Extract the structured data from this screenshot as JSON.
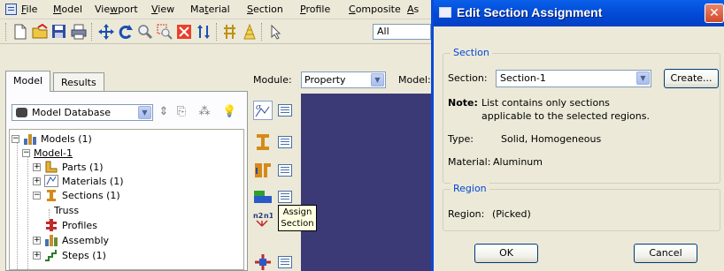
{
  "menubar": {
    "items": [
      "File",
      "Model",
      "Viewport",
      "View",
      "Material",
      "Section",
      "Profile",
      "Composite",
      "As"
    ],
    "mnemonics": [
      "F",
      "M",
      "w",
      "V",
      "t",
      "S",
      "P",
      "C",
      "A"
    ]
  },
  "toolbar": {
    "filter_value": "All"
  },
  "tabs": [
    "Model",
    "Results"
  ],
  "model_db": {
    "selected": "Model Database"
  },
  "tree": {
    "models": "Models (1)",
    "model1": "Model-1",
    "parts": "Parts (1)",
    "materials": "Materials (1)",
    "sections": "Sections (1)",
    "truss": "Truss",
    "profiles": "Profiles",
    "assembly": "Assembly",
    "steps": "Steps (1)"
  },
  "module_bar": {
    "module_label": "Module:",
    "module_value": "Property",
    "model_label": "Model:"
  },
  "tooltip": {
    "line1": "Assign",
    "line2": "Section"
  },
  "dialog": {
    "title": "Edit Section Assignment",
    "section_group": "Section",
    "section_label": "Section:",
    "section_value": "Section-1",
    "create_button": "Create...",
    "note_label": "Note:",
    "note_line1": "List contains only sections",
    "note_line2": "applicable to the selected regions.",
    "type_label": "Type:",
    "type_value": "Solid, Homogeneous",
    "material_label": "Material:",
    "material_value": "Aluminum",
    "region_group": "Region",
    "region_label": "Region:",
    "region_value": "(Picked)",
    "ok_button": "OK",
    "cancel_button": "Cancel"
  },
  "colors": {
    "xp_title_blue": "#0148d4",
    "canvas_navy": "#3b3a76",
    "group_label_blue": "#0046d5",
    "close_red": "#d2492a"
  }
}
